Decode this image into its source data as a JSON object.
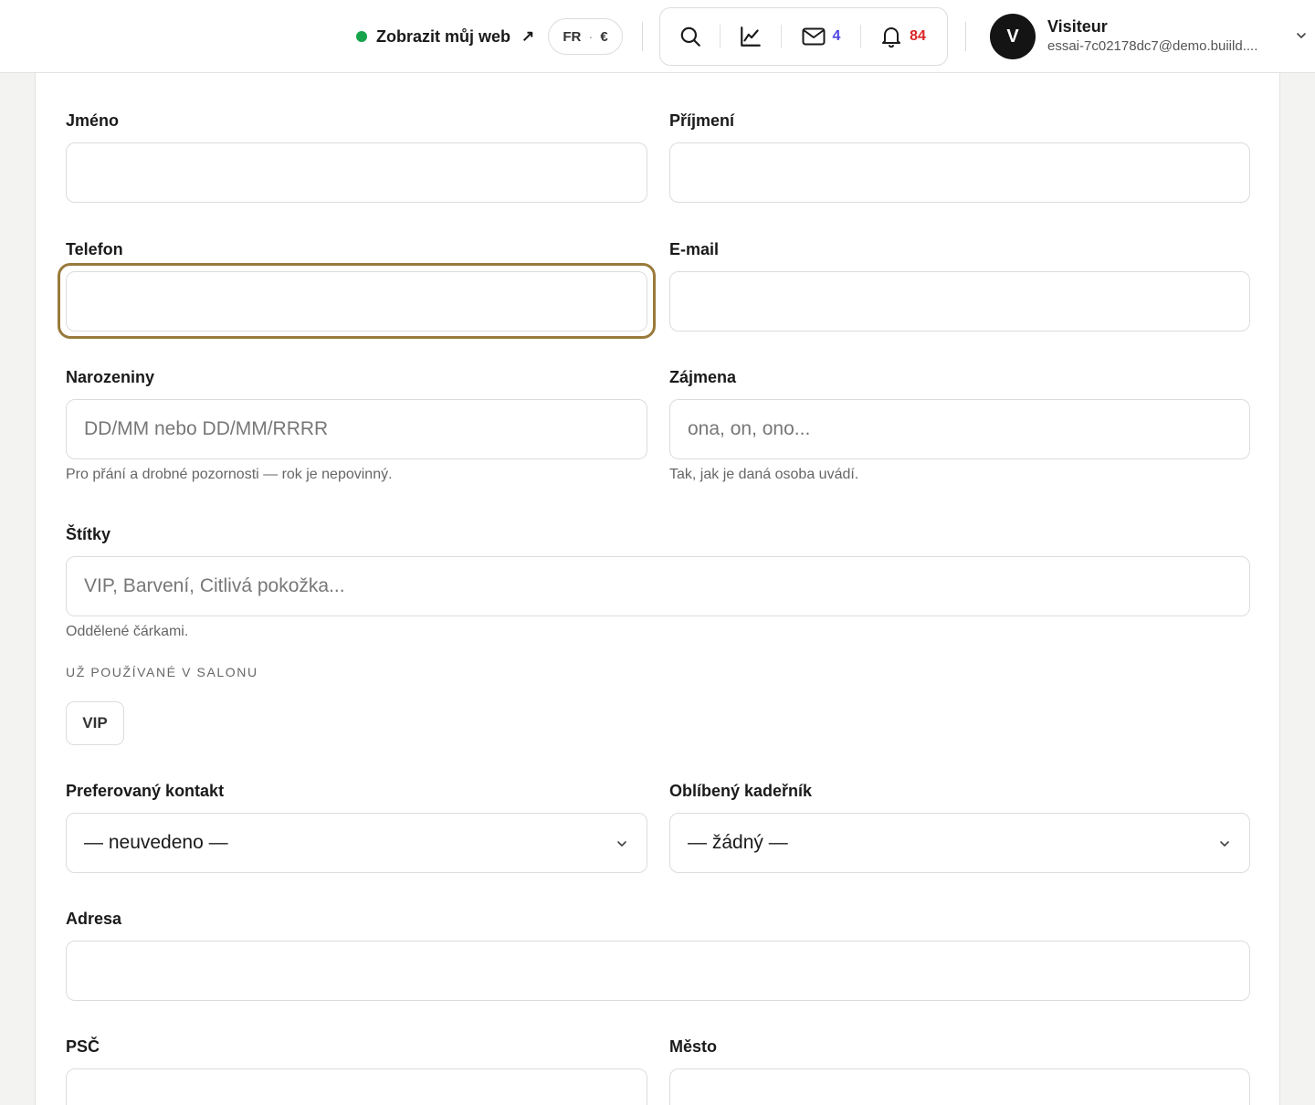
{
  "header": {
    "site_link_label": "Zobrazit můj web",
    "site_link_arrow": "↗",
    "locale": {
      "language": "FR",
      "separator": "·",
      "currency": "€"
    },
    "icons": {
      "search": "search-icon",
      "stats": "chart-line-icon",
      "mail": "mail-icon",
      "notifications": "bell-icon"
    },
    "mail_count": "4",
    "notification_count": "84",
    "user": {
      "initial": "V",
      "name": "Visiteur",
      "email": "essai-7c02178dc7@demo.buiild...."
    },
    "colors": {
      "status_dot": "#16a34a",
      "mail_badge": "#4f46e5",
      "notification_badge": "#dc2626"
    }
  },
  "form": {
    "first_name": {
      "label": "Jméno",
      "value": "",
      "placeholder": ""
    },
    "last_name": {
      "label": "Příjmení",
      "value": "",
      "placeholder": ""
    },
    "phone": {
      "label": "Telefon",
      "value": "",
      "placeholder": ""
    },
    "email": {
      "label": "E-mail",
      "value": "",
      "placeholder": ""
    },
    "birthday": {
      "label": "Narozeniny",
      "value": "",
      "placeholder": "DD/MM nebo DD/MM/RRRR",
      "hint": "Pro přání a drobné pozornosti — rok je nepovinný."
    },
    "pronouns": {
      "label": "Zájmena",
      "value": "",
      "placeholder": "ona, on, ono...",
      "hint": "Tak, jak je daná osoba uvádí."
    },
    "tags": {
      "label": "Štítky",
      "value": "",
      "placeholder": "VIP, Barvení, Citlivá pokožka...",
      "hint": "Oddělené čárkami.",
      "used_title": "UŽ POUŽÍVANÉ V SALONU",
      "used_tags": [
        "VIP"
      ]
    },
    "preferred_contact": {
      "label": "Preferovaný kontakt",
      "selected": "— neuvedeno —"
    },
    "favorite_stylist": {
      "label": "Oblíbený kadeřník",
      "selected": "— žádný —"
    },
    "address": {
      "label": "Adresa",
      "value": ""
    },
    "zip": {
      "label": "PSČ",
      "value": ""
    },
    "city": {
      "label": "Město",
      "value": ""
    },
    "focus_color": "#9a7a3c"
  }
}
